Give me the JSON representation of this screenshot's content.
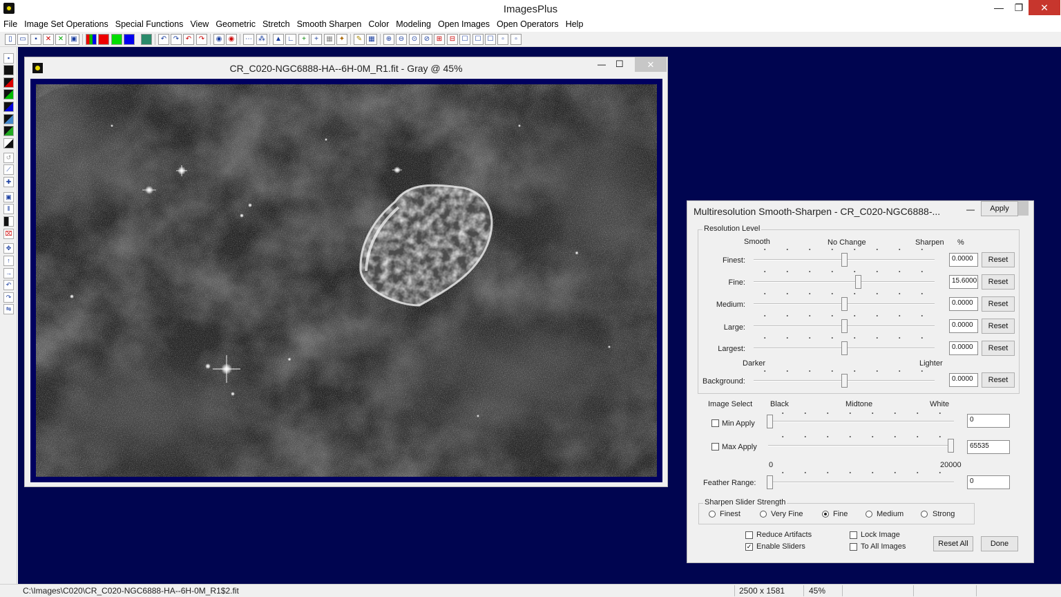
{
  "app": {
    "title": "ImagesPlus",
    "min_glyph": "—",
    "max_glyph": "❐",
    "close_glyph": "✕"
  },
  "menu": [
    "File",
    "Image Set Operations",
    "Special Functions",
    "View",
    "Geometric",
    "Stretch",
    "Smooth Sharpen",
    "Color",
    "Modeling",
    "Open Images",
    "Open Operators",
    "Help"
  ],
  "image_window": {
    "title": "CR_C020-NGC6888-HA--6H-0M_R1.fit - Gray @ 45%",
    "min_glyph": "—",
    "max_glyph": "☐",
    "close_glyph": "✕"
  },
  "dialog": {
    "title": "Multiresolution Smooth-Sharpen - CR_C020-NGC6888-...",
    "min_glyph": "—",
    "max_glyph": "☐",
    "close_glyph": "✕",
    "resolution_group": "Resolution Level",
    "smooth_label": "Smooth",
    "nochange_label": "No Change",
    "sharpen_label": "Sharpen",
    "percent_label": "%",
    "levels": [
      {
        "label": "Finest:",
        "value": "0.0000",
        "reset": "Reset",
        "position": 0.5
      },
      {
        "label": "Fine:",
        "value": "15.6000",
        "reset": "Reset",
        "position": 0.578
      },
      {
        "label": "Medium:",
        "value": "0.0000",
        "reset": "Reset",
        "position": 0.5
      },
      {
        "label": "Large:",
        "value": "0.0000",
        "reset": "Reset",
        "position": 0.5
      },
      {
        "label": "Largest:",
        "value": "0.0000",
        "reset": "Reset",
        "position": 0.5
      }
    ],
    "darker_label": "Darker",
    "lighter_label": "Lighter",
    "background": {
      "label": "Background:",
      "value": "0.0000",
      "reset": "Reset",
      "position": 0.5
    },
    "image_select_label": "Image Select",
    "black_label": "Black",
    "midtone_label": "Midtone",
    "white_label": "White",
    "min_apply": {
      "label": "Min Apply",
      "checked": false,
      "value": "0",
      "position": 0.0
    },
    "max_apply": {
      "label": "Max Apply",
      "checked": false,
      "value": "65535",
      "position": 1.0
    },
    "feather_min": "0",
    "feather_max": "20000",
    "feather": {
      "label": "Feather Range:",
      "value": "0",
      "position": 0.0
    },
    "strength_group": "Sharpen Slider Strength",
    "strength_options": [
      {
        "label": "Finest",
        "selected": false
      },
      {
        "label": "Very Fine",
        "selected": false
      },
      {
        "label": "Fine",
        "selected": true
      },
      {
        "label": "Medium",
        "selected": false
      },
      {
        "label": "Strong",
        "selected": false
      }
    ],
    "apply_button": "Apply",
    "reduce_artifacts": {
      "label": "Reduce Artifacts",
      "checked": false
    },
    "enable_sliders": {
      "label": "Enable Sliders",
      "checked": true
    },
    "lock_image": {
      "label": "Lock Image",
      "checked": false
    },
    "to_all_images": {
      "label": "To All Images",
      "checked": false
    },
    "reset_all_button": "Reset All",
    "done_button": "Done",
    "check_glyph": "✓"
  },
  "status": {
    "path": "C:\\Images\\C020\\CR_C020-NGC6888-HA--6H-0M_R1$2.fit",
    "dimensions": "2500 x 1581",
    "zoom": "45%"
  }
}
